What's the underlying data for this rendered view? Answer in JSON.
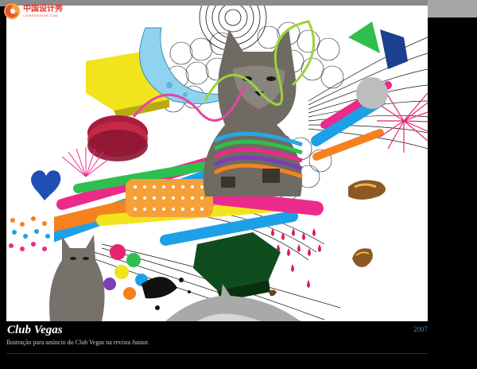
{
  "site": {
    "logo_cn": "中国设计秀",
    "logo_en": "CNWEBSHOW.COM"
  },
  "artwork": {
    "title": "Club Vegas",
    "year": "2007",
    "description": "Ilustração para anúncio do Club Vegas na revista Junior."
  },
  "colors": {
    "background": "#000000",
    "title": "#ffffff",
    "year": "#3b84c7",
    "logo": "#e23b2a"
  }
}
